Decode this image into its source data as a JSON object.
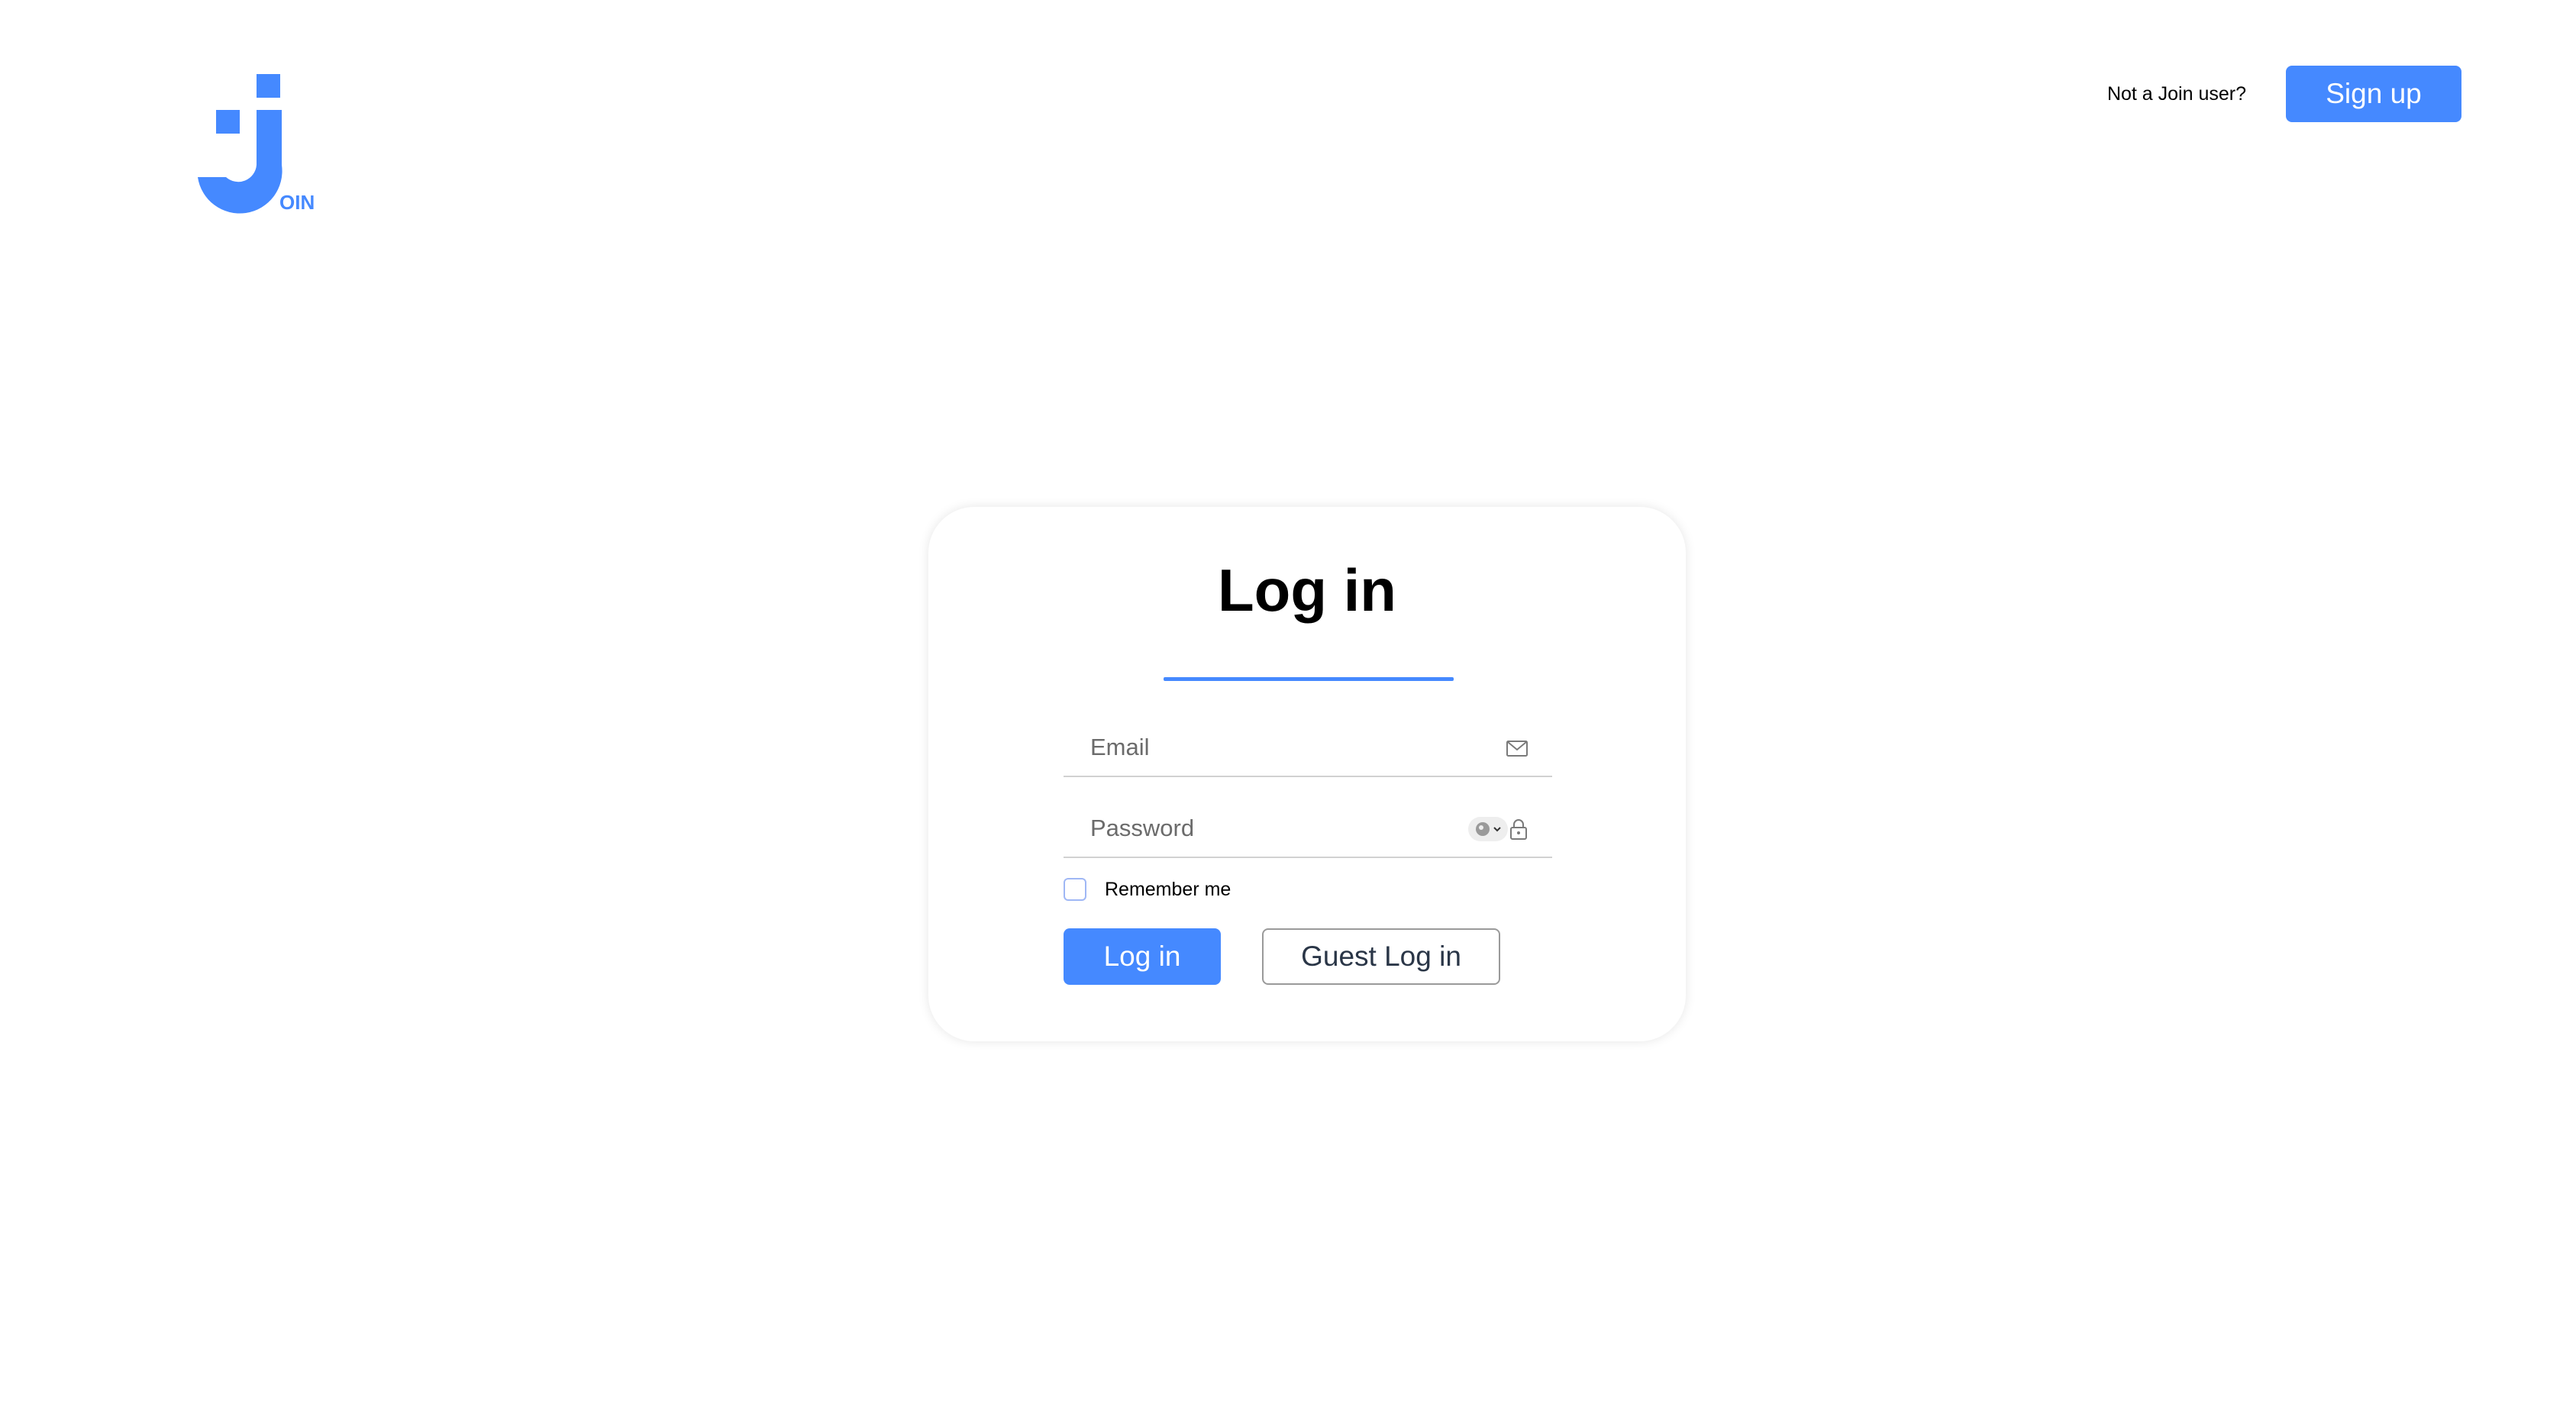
{
  "logo": {
    "text": "OIN",
    "icon": "join-logo-icon"
  },
  "header": {
    "not_user_text": "Not a Join user?",
    "signup_label": "Sign up"
  },
  "login": {
    "title": "Log in",
    "email_placeholder": "Email",
    "email_value": "",
    "password_placeholder": "Password",
    "password_value": "",
    "remember_label": "Remember me",
    "remember_checked": false,
    "login_button_label": "Log in",
    "guest_button_label": "Guest Log in"
  },
  "colors": {
    "accent": "#4589ff",
    "text_dark": "#2a3647",
    "field_border": "#d1d1d1"
  }
}
